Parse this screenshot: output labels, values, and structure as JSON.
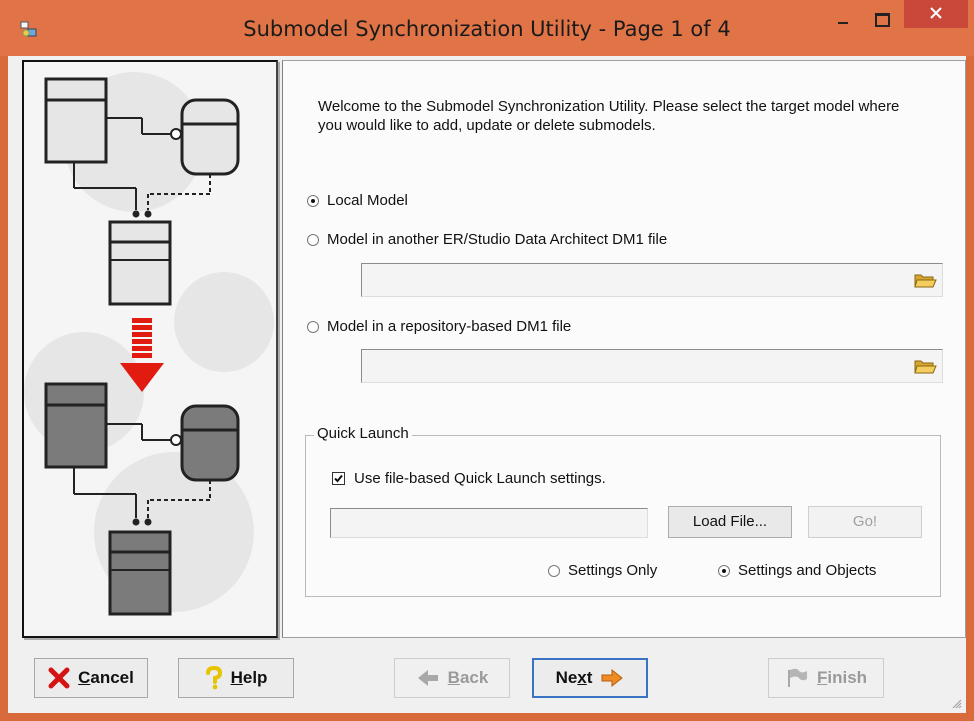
{
  "window": {
    "title": "Submodel Synchronization Utility - Page 1 of 4",
    "accent_color": "#e07446",
    "close_color": "#c9483a"
  },
  "intro": {
    "welcome_text": "Welcome to the Submodel Synchronization Utility.  Please select the target model where you would like to add, update or delete submodels."
  },
  "target": {
    "local_model_label": "Local Model",
    "local_model_selected": true,
    "other_file_label": "Model in another ER/Studio Data Architect DM1 file",
    "other_file_selected": false,
    "other_file_path": "",
    "repository_label": "Model in a repository-based DM1 file",
    "repository_selected": false,
    "repository_path": ""
  },
  "quick_launch": {
    "legend": "Quick Launch",
    "use_file_settings_label": "Use file-based Quick Launch settings.",
    "use_file_settings_checked": true,
    "file_path": "",
    "load_file_label": "Load File...",
    "go_label": "Go!",
    "settings_only_label": "Settings Only",
    "settings_only_selected": false,
    "settings_and_objects_label": "Settings and Objects",
    "settings_and_objects_selected": true
  },
  "footer": {
    "cancel": {
      "pre": "",
      "ul": "C",
      "post": "ancel"
    },
    "help": {
      "pre": "",
      "ul": "H",
      "post": "elp"
    },
    "back": {
      "pre": "",
      "ul": "B",
      "post": "ack"
    },
    "next": {
      "pre": "Ne",
      "ul": "x",
      "post": "t"
    },
    "finish": {
      "pre": "",
      "ul": "F",
      "post": "inish"
    }
  },
  "icons": {
    "app": "app-icon",
    "folder": "folder-open-icon",
    "cancel": "red-x-icon",
    "help": "question-mark-icon",
    "back": "left-arrow-icon",
    "next": "right-arrow-icon",
    "finish": "finish-flag-icon"
  }
}
